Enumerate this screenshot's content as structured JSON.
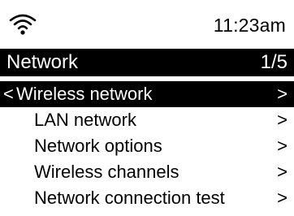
{
  "status": {
    "time": "11:23am",
    "wifi_icon": "wifi-icon"
  },
  "header": {
    "title": "Network",
    "page_indicator": "1/5"
  },
  "menu": {
    "back_glyph": "<",
    "arrow_glyph": ">",
    "items": [
      {
        "label": "Wireless network",
        "selected": true
      },
      {
        "label": "LAN network",
        "selected": false
      },
      {
        "label": "Network options",
        "selected": false
      },
      {
        "label": "Wireless channels",
        "selected": false
      },
      {
        "label": "Network connection test",
        "selected": false
      }
    ]
  },
  "colors": {
    "background": "#ffffff",
    "foreground": "#000000",
    "highlight": "#000000",
    "highlight_text": "#ffffff"
  }
}
